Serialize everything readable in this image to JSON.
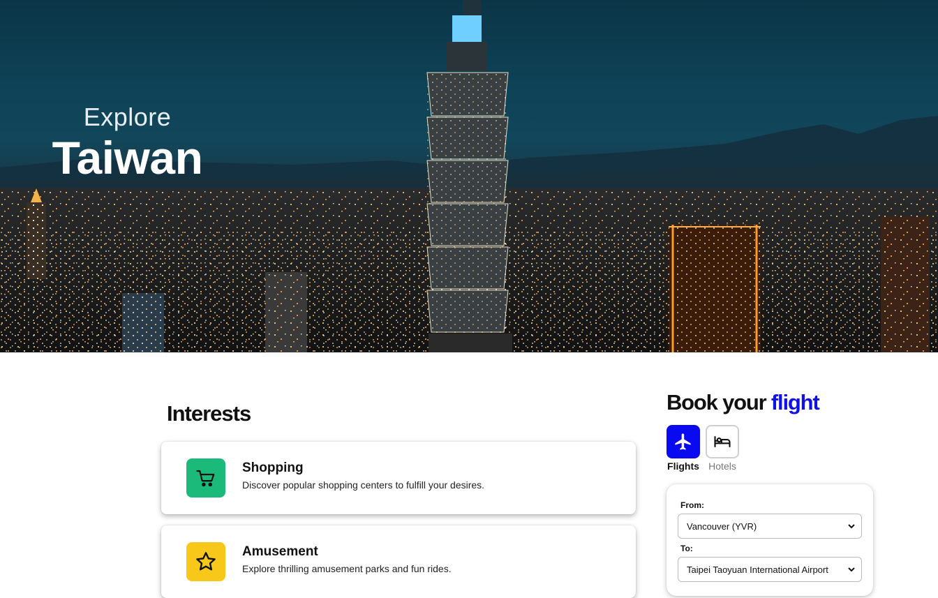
{
  "hero": {
    "subtitle": "Explore",
    "title": "Taiwan"
  },
  "interests": {
    "heading": "Interests",
    "items": [
      {
        "title": "Shopping",
        "description": "Discover popular shopping centers to fulfill your desires.",
        "icon": "shopping-cart-icon",
        "color": "#1bb97a"
      },
      {
        "title": "Amusement",
        "description": "Explore thrilling amusement parks and fun rides.",
        "icon": "star-icon",
        "color": "#f7c81a"
      }
    ]
  },
  "booking": {
    "heading_prefix": "Book your",
    "heading_accent": "flight",
    "accent_color": "#1010e8",
    "modes": [
      {
        "label": "Flights",
        "icon": "airplane-icon",
        "active": true
      },
      {
        "label": "Hotels",
        "icon": "bed-icon",
        "active": false
      }
    ],
    "form": {
      "from_label": "From:",
      "from_value": "Vancouver (YVR)",
      "to_label": "To:",
      "to_value": "Taipei Taoyuan International Airport"
    }
  }
}
